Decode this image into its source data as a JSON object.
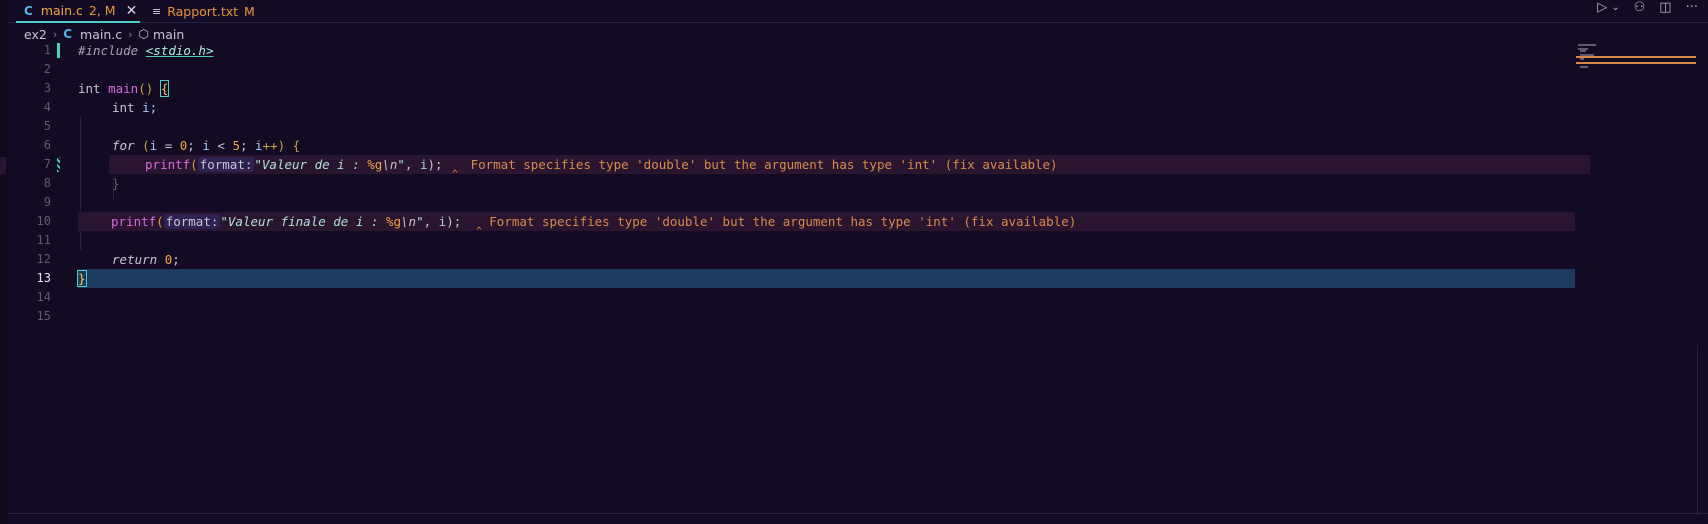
{
  "tabs": [
    {
      "lang": "C",
      "title": "main.c",
      "badge": "2, M",
      "close": "✕"
    },
    {
      "icon": "≡",
      "title": "Rapport.txt",
      "badge": "M"
    }
  ],
  "actions": {
    "run": "▷",
    "run_menu": "⌄",
    "compare": "⚇",
    "split": "◫",
    "more": "···"
  },
  "breadcrumb": {
    "folder": "ex2",
    "lang": "C",
    "file": "main.c",
    "symbol_icon": "⬡",
    "symbol": "main",
    "sep": "›"
  },
  "lines": {
    "n1": "1",
    "n2": "2",
    "n3": "3",
    "n4": "4",
    "n5": "5",
    "n6": "6",
    "n7": "7",
    "n8": "8",
    "n9": "9",
    "n10": "10",
    "n11": "11",
    "n12": "12",
    "n13": "13",
    "n14": "14",
    "n15": "15"
  },
  "code": {
    "l1_pre": "#include",
    "l1_inc": "<stdio.h>",
    "l3_type": "int",
    "l3_fn": "main",
    "l3_paren": "()",
    "l3_brace": "{",
    "l4_type": "int",
    "l4_var": "i;",
    "l6_kw": "for",
    "l6_rest_a": " (",
    "l6_i1": "i",
    "l6_rest_b": " = ",
    "l6_zero": "0",
    "l6_rest_c": "; ",
    "l6_i2": "i",
    "l6_rest_d": " < ",
    "l6_five": "5",
    "l6_rest_e": "; ",
    "l6_i3": "i",
    "l6_rest_f": "++) {",
    "l7_fn": "printf",
    "l7_paren": "(",
    "l7_hint": "format:",
    "l7_str": "\"Valeur de i : ",
    "l7_fmt": "%g",
    "l7_esc": "\\n",
    "l7_strq": "\"",
    "l7_comma": ", ",
    "l7_i": "i",
    "l7_end": ");",
    "l7_diag": "Format specifies type 'double' but the argument has type 'int' (fix available)",
    "l8_brace": "}",
    "l10_fn": "printf",
    "l10_paren": "(",
    "l10_hint": "format:",
    "l10_str": "\"Valeur finale de i : ",
    "l10_fmt": "%g",
    "l10_esc": "\\n",
    "l10_strq": "\"",
    "l10_comma": ", ",
    "l10_i": "i",
    "l10_end": ");",
    "l10_diag": "Format specifies type 'double' but the argument has type 'int' (fix available)",
    "l12_kw": "return",
    "l12_zero": "0",
    "l12_end": ";",
    "l13_brace": "}",
    "squiggle": "^"
  },
  "colors": {
    "accent": "#4ecdc4",
    "warning": "#d88a4a",
    "background": "#130b24",
    "current_line": "#1c3a5c"
  }
}
